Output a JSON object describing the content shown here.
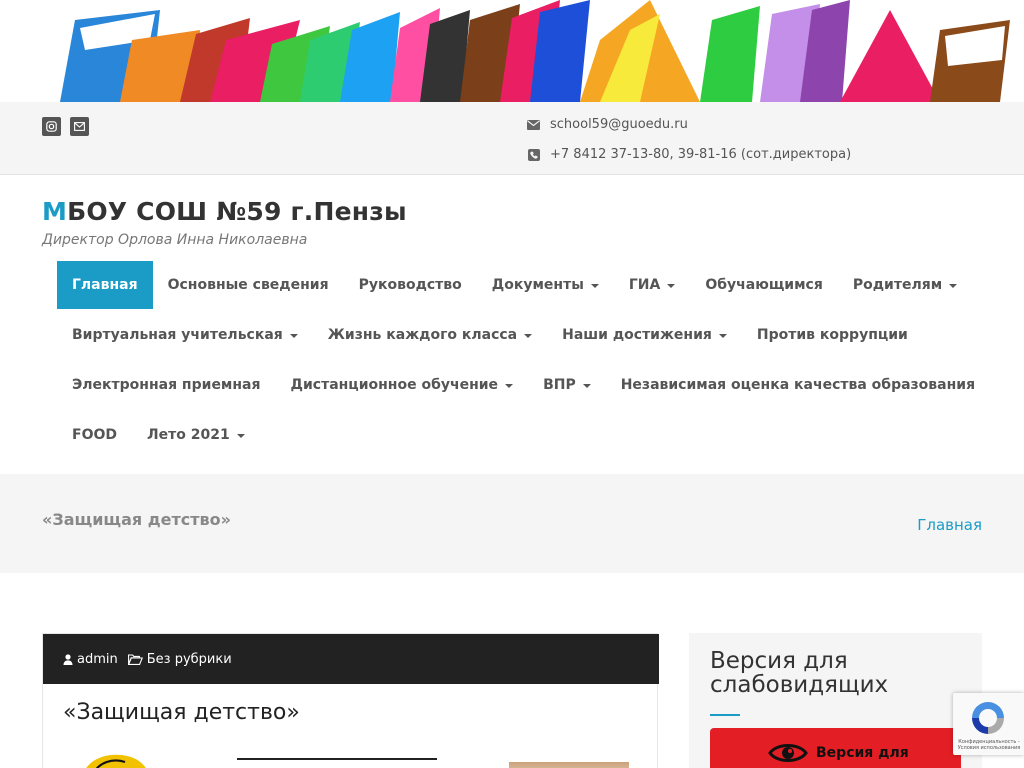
{
  "topbar": {
    "email": "school59@guoedu.ru",
    "phone": "+7 8412 37-13-80, 39-81-16 (сот.директора)"
  },
  "icons": {
    "instagram": "instagram-icon",
    "mail": "envelope-icon",
    "phone": "phone-icon",
    "user": "user-icon",
    "folder": "folder-open-icon",
    "eye": "eye-icon"
  },
  "site": {
    "title_first": "М",
    "title_rest": "БОУ СОШ №59 г.Пензы",
    "description": "Директор Орлова Инна Николаевна"
  },
  "nav": {
    "rows": [
      [
        {
          "label": "Главная",
          "active": true,
          "dropdown": false
        },
        {
          "label": "Основные сведения",
          "dropdown": false
        },
        {
          "label": "Руководство",
          "dropdown": false
        },
        {
          "label": "Документы",
          "dropdown": true
        },
        {
          "label": "ГИА",
          "dropdown": true
        },
        {
          "label": "Обучающимся",
          "dropdown": false
        },
        {
          "label": "Родителям",
          "dropdown": true
        }
      ],
      [
        {
          "label": "Виртуальная учительская",
          "dropdown": true
        },
        {
          "label": "Жизнь каждого класса",
          "dropdown": true
        },
        {
          "label": "Наши достижения",
          "dropdown": true
        },
        {
          "label": "Против коррупции",
          "dropdown": false
        }
      ],
      [
        {
          "label": "Электронная приемная",
          "dropdown": false
        },
        {
          "label": "Дистанционное обучение",
          "dropdown": true
        },
        {
          "label": "ВПР",
          "dropdown": true
        },
        {
          "label": "Независимая оценка качества образования",
          "dropdown": false
        }
      ],
      [
        {
          "label": "FOOD",
          "dropdown": false
        },
        {
          "label": "Лето 2021",
          "dropdown": true
        }
      ]
    ]
  },
  "page": {
    "heading": "«Защищая детство»",
    "breadcrumb": "Главная"
  },
  "post": {
    "author": "admin",
    "category": "Без рубрики",
    "title": "«Защищая детство»"
  },
  "sidebar": {
    "title": "Версия для слабовидящих",
    "button_label": "Версия для"
  },
  "recaptcha": {
    "text": "Конфиденциальность - Условия использования"
  },
  "colors": {
    "accent": "#1a9cc7",
    "dark": "#222222",
    "vi_button": "#e31e24"
  }
}
